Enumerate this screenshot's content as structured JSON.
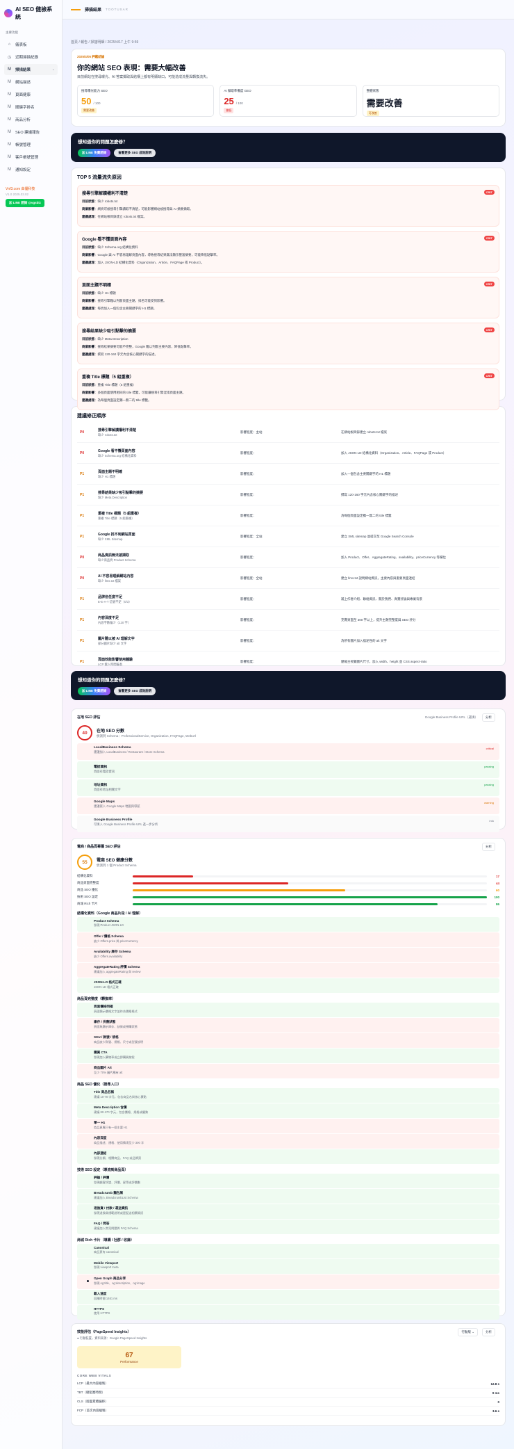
{
  "brand": {
    "name": "AI SEO 健檢系統"
  },
  "sidebar": {
    "section": "主要功能",
    "items": [
      {
        "icon": "⌂",
        "label": "儀表板"
      },
      {
        "icon": "◷",
        "label": "近期掃描紀錄"
      },
      {
        "icon": "M",
        "label": "掃描結果"
      },
      {
        "icon": "M",
        "label": "網站描述"
      },
      {
        "icon": "M",
        "label": "頁面健康"
      },
      {
        "icon": "M",
        "label": "關鍵字排名"
      },
      {
        "icon": "M",
        "label": "商品分析"
      },
      {
        "icon": "M",
        "label": "SEO 建議報告"
      },
      {
        "icon": "M",
        "label": "帳號管理"
      },
      {
        "icon": "M",
        "label": "客戶帳號管理"
      },
      {
        "icon": "M",
        "label": "通知設定"
      }
    ],
    "footer_brand": "Vnf3.com 由優科技",
    "version": "V1.0  2025.03.02",
    "line_button": "加 LINE 諮詢 @vgsbiz"
  },
  "topbar": {
    "title": "掃描結果",
    "subtitle": "TOOTUSAR"
  },
  "breadcrumb": "首頁 / 報告 / 掃描明細 / 2025/4/17 上午 9:59",
  "hero": {
    "tag": "2025/4/05 評鑑結論",
    "title": "你的網站 SEO 表現：需要大幅改善",
    "desc": "目前網站在搜尋曝光、AI 答案擷取與結構上都有明顯缺口，可能造成流量與轉換流失。",
    "stats": [
      {
        "label": "搜尋曝光能力 SEO",
        "value": "50",
        "unit": "/ 100",
        "badge": "需要改善"
      },
      {
        "label": "AI 擷取準備度 GEO",
        "value": "25",
        "unit": "/ 100",
        "badge": "偏低"
      },
      {
        "label": "整體狀態",
        "value": "需要改善",
        "unit": "",
        "badge": "可改善"
      }
    ]
  },
  "banner": {
    "title": "想知道你的問題怎麼修？",
    "btn1": "加 LINE 免費諮詢",
    "btn2": "查看更多 SEO 成效說明"
  },
  "issues_section": {
    "title": "TOP 5 流量流失原因",
    "labels": {
      "issue": "目前狀態",
      "impact": "商業影響",
      "fix": "建議處理"
    },
    "crit_label": "CRIT",
    "items": [
      {
        "title": "搜尋引擎解讀權利不清楚",
        "issue": "缺少 robots.txt",
        "impact": "網頁可被搜尋引擎讀取不清楚，可能影響網站被搜尋與 AI 摘要擷取。",
        "fix": "在網站根目錄建立 robots.txt 檔案。"
      },
      {
        "title": "Google 看不懂頁面內容",
        "issue": "缺少 Schema.org 結構化資料",
        "impact": "Google 與 AI 不容易理解頁面內容，導致搜尋結果無法顯示豐富摘要，可能降低點擊率。",
        "fix": "加入 JSON-LD 結構化資料（Organization、Article、FAQPage 或 Product）。"
      },
      {
        "title": "頁面主題不明確",
        "issue": "缺少 H1 標題",
        "impact": "搜尋引擎難以判斷頁面主題，排名可能受到影響。",
        "fix": "每頁加入一個包含主要關鍵字的 H1 標題。"
      },
      {
        "title": "搜尋結果缺少吸引點擊的摘要",
        "issue": "缺少 Meta Description",
        "impact": "搜尋結果摘要可能不完整，Google 難以判斷主要內容，降低點擊率。",
        "fix": "撰寫 120-160 字元內含核心關鍵字的描述。"
      },
      {
        "title": "重複 Title 標題（5 組重複）",
        "issue": "重複 Title 標題（5 組重複）",
        "impact": "多個頁面使用相同的 title 標籤，可能讓搜尋引擎混淆頁面主題。",
        "fix": "為每個頁面設定獨一無二的 title 標籤。"
      }
    ]
  },
  "fix_section": {
    "title": "建議修正順序",
    "col_impact": "影響程度：",
    "col_action": "預計：",
    "rows": [
      {
        "pri": "P0",
        "title": "搜尋引擎解讀權利不清楚",
        "sub": "缺少 robots.txt",
        "impact": "影響程度：主站",
        "action": "在網站根目錄建立 robots.txt 檔案"
      },
      {
        "pri": "P0",
        "title": "Google 看不懂頁面內容",
        "sub": "缺少 Schema.org 結構化資料",
        "impact": "影響程度：",
        "action": "加入 JSON-LD 結構化資料（Organization、Article、FAQPage 或 Product）"
      },
      {
        "pri": "P1",
        "title": "頁面主題不明確",
        "sub": "缺少 H1 標題",
        "impact": "影響程度：",
        "action": "加入一個包含主要關鍵字的 H1 標題"
      },
      {
        "pri": "P1",
        "title": "搜尋結果缺少吸引點擊的摘要",
        "sub": "缺少 Meta Description",
        "impact": "影響程度：",
        "action": "撰寫 120-160 字元內含核心關鍵字的描述"
      },
      {
        "pri": "P1",
        "title": "重複 Title 標題（5 組重複）",
        "sub": "重複 Title 標題（5 組重複）",
        "impact": "影響程度：",
        "action": "為每個頁面設定獨一無二的 title 標籤"
      },
      {
        "pri": "P1",
        "title": "Google 找不到網站頁面",
        "sub": "缺少 XML Sitemap",
        "impact": "影響程度：全站",
        "action": "建立 XML sitemap 並提交至 Google Search Console"
      },
      {
        "pri": "P0",
        "title": "商品資訊無法被擷取",
        "sub": "缺少商品頁 Product Schema",
        "impact": "影響程度：",
        "action": "加入 Product、Offer、AggregateRating、availability、priceCurrency 等欄位"
      },
      {
        "pri": "P0",
        "title": "AI 不容易理解網站內容",
        "sub": "缺少 llms.txt 檔案",
        "impact": "影響程度：全站",
        "action": "建立 llms.txt 說明網站資訊，主要內容與重要頁面連結"
      },
      {
        "pri": "P1",
        "title": "品牌信任度不足",
        "sub": "E-E-A-T 信號不足（0/3）",
        "impact": "影響程度：",
        "action": "補上作者介紹、聯絡資訊、關於我們、真實評論與專業背景"
      },
      {
        "pri": "P1",
        "title": "內容深度不足",
        "sub": "內容字數偏少（120 字）",
        "impact": "影響程度：",
        "action": "充實頁面至 300 字以上，提升主題完整度與 SEO 評分"
      },
      {
        "pri": "P1",
        "title": "圖片難以被 AI 理解文字",
        "sub": "部分圖片缺少 alt 文字",
        "impact": "影響程度：",
        "action": "為所有圖片加入描述性的 alt 文字"
      },
      {
        "pri": "P1",
        "title": "頁面效能影響使用體驗",
        "sub": "LCP 載入時間偏長",
        "impact": "影響程度：",
        "action": "壓縮主視覺圖片尺寸，加入 width、height 並 CSS aspect-ratio"
      }
    ]
  },
  "banner2": {
    "title": "想知道你的問題怎麼修？",
    "btn1": "加 LINE 免費諮詢",
    "btn2": "查看更多 SEO 成效說明"
  },
  "local_seo": {
    "title": "在地 SEO 評估",
    "input_label": "Google Business Profile URL（選填）",
    "analyze": "分析",
    "score": "40",
    "score_title": "在地 SEO 分數",
    "score_sub": "偵測到 Schema：ProfessionalService, Organization, FAQPage, WebUrl",
    "checks": [
      {
        "title": "LocalBusiness Schema",
        "sub": "建議加入 LocalBusiness / Restaurant / Store Schema",
        "tag": "critical",
        "state": "fail"
      },
      {
        "title": "電話資訊",
        "sub": "頁面有電話資訊",
        "tag": "passing",
        "state": "pass"
      },
      {
        "title": "地址資訊",
        "sub": "頁面有地址相關文字",
        "tag": "passing",
        "state": "pass"
      },
      {
        "title": "Google Maps",
        "sub": "建議嵌入 Google Maps 地圖與導航",
        "tag": "warning",
        "state": "fail"
      },
      {
        "title": "Google Business Profile",
        "sub": "可填入 Google Business Profile URL 進一步分析",
        "tag": "info",
        "state": "neutral"
      }
    ]
  },
  "product_seo": {
    "title": "電商 / 商品頁專屬 SEO 評估",
    "analyze": "分析",
    "score": "55",
    "score_title": "電商 SEO 健康分數",
    "score_sub": "偵測到 1 個 Product Schema",
    "bars": [
      {
        "label": "結構化資料",
        "value": 17,
        "color": "#dc2626"
      },
      {
        "label": "商品頁面完整度",
        "value": 44,
        "color": "#dc2626"
      },
      {
        "label": "商品 SEO 優化",
        "value": 60,
        "color": "#f59e0b"
      },
      {
        "label": "技術 SEO 設定",
        "value": 100,
        "color": "#16a34a"
      },
      {
        "label": "商城 Rich 卡片",
        "value": 86,
        "color": "#16a34a"
      }
    ],
    "groups": [
      {
        "title": "結構化資料（Google 商品片段 / AI 理解）",
        "items": [
          {
            "title": "Product Schema",
            "sub": "發現 Product JSON-LD",
            "state": "pass"
          },
          {
            "title": "Offer / 價格 Schema",
            "sub": "缺少 Offers.price 與 priceCurrency",
            "state": "fail"
          },
          {
            "title": "Availability 庫存 Schema",
            "sub": "缺少 Offers.availability",
            "state": "fail"
          },
          {
            "title": "AggregateRating 評價 Schema",
            "sub": "建議加入 aggregateRating 與 review",
            "state": "fail"
          },
          {
            "title": "JSON-LD 格式正確",
            "sub": "JSON-LD 格式正確",
            "state": "pass"
          }
        ]
      },
      {
        "title": "商品頁完整度（轉換率）",
        "items": [
          {
            "title": "頁面價格明確",
            "sub": "頁面顯示價格文字並符合價格格式",
            "state": "pass"
          },
          {
            "title": "庫存 / 供應狀態",
            "sub": "頁面無顯示庫存、缺貨或預購狀態",
            "state": "fail"
          },
          {
            "title": "SKU / 款號 / 規格",
            "sub": "商品缺少款號、規格、尺寸或型號說明",
            "state": "fail"
          },
          {
            "title": "購買 CTA",
            "sub": "發現加入購物車或立即購買按鈕",
            "state": "pass"
          },
          {
            "title": "商品圖片 Alt",
            "sub": "至少 70% 圖片應有 alt",
            "state": "fail"
          }
        ]
      },
      {
        "title": "商品 SEO 優化（搜尋入口）",
        "items": [
          {
            "title": "Title 商品名稱",
            "sub": "建議 10-70 字元，包含商品名與核心賣點",
            "state": "pass"
          },
          {
            "title": "Meta Description 含價",
            "sub": "建議 80-170 字元，包含價格、規格或優勢",
            "state": "pass"
          },
          {
            "title": "單一 H1",
            "sub": "商品頁應只有一個主要 H1",
            "state": "fail"
          },
          {
            "title": "內容深度",
            "sub": "商品描述、規格、使用情境至少 300 字",
            "state": "fail"
          },
          {
            "title": "內部連結",
            "sub": "發現分類、相關商品、FAQ 或品牌頁",
            "state": "pass"
          }
        ]
      },
      {
        "title": "技術 SEO 設定（導流到商品頁）",
        "items": [
          {
            "title": "評論 / 評價",
            "sub": "發現顧客評論、評價、星等或評價數",
            "state": "pass"
          },
          {
            "title": "Breadcrumb 麵包屑",
            "sub": "建議加入 BreadcrumbList Schema",
            "state": "pass"
          },
          {
            "title": "退換貨 / 付款 / 運送資訊",
            "sub": "發現退換貨規範說明或是配送相關資訊",
            "state": "pass"
          },
          {
            "title": "FAQ / 問答",
            "sub": "建議加入常見問題與 FAQ Schema",
            "state": "pass"
          }
        ]
      },
      {
        "title": "商城 Rich 卡片（導購 / 社群 / 收錄）",
        "items": [
          {
            "title": "Canonical",
            "sub": "商品頁有 canonical",
            "state": "pass"
          },
          {
            "title": "Mobile Viewport",
            "sub": "發現 viewport meta",
            "state": "pass"
          },
          {
            "title": "Open Graph 商品分享",
            "sub": "發現 og:title、og:description、og:image",
            "state": "fail"
          },
          {
            "title": "載入速度",
            "sub": "回應時間 1461 ms",
            "state": "pass"
          },
          {
            "title": "HTTPS",
            "sub": "使用 HTTPS",
            "state": "pass"
          }
        ]
      }
    ]
  },
  "perf": {
    "title": "效能評估（PageSpeed Insights）",
    "note": "● 行動裝置，資料來源：Google PageSpeed Insights",
    "device": "行動版 ⌄",
    "analyze": "分析",
    "score": "67",
    "score_label": "Performance",
    "cwv_title": "CORE WEB VITALS",
    "metrics": [
      {
        "label": "LCP（最大內容繪製）",
        "value": "12.8 s"
      },
      {
        "label": "TBT（總阻塞時間）",
        "value": "0 ms"
      },
      {
        "label": "CLS（版面累積偏移）",
        "value": "0"
      },
      {
        "label": "FCP（首次內容繪製）",
        "value": "3.6 s"
      }
    ]
  }
}
